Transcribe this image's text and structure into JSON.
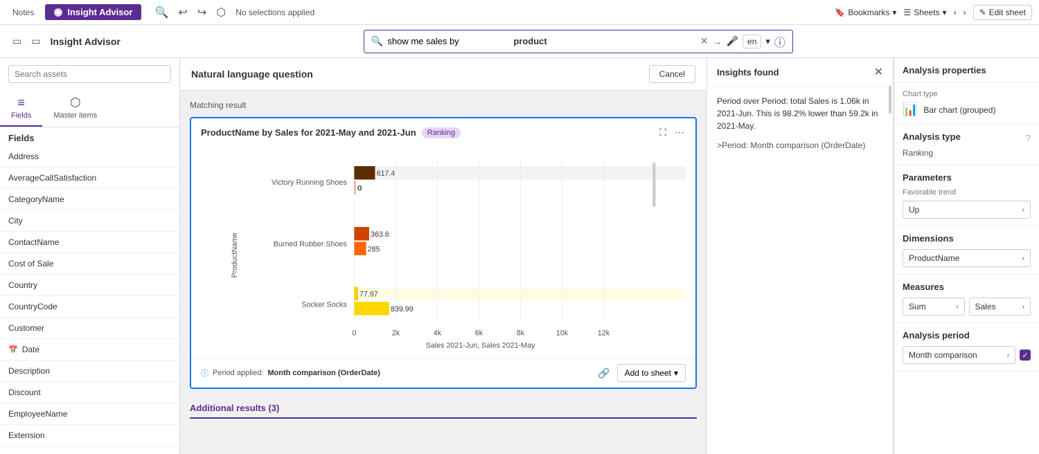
{
  "topbar": {
    "notes_label": "Notes",
    "insight_advisor_label": "Insight Advisor",
    "selections_label": "No selections applied",
    "bookmarks_label": "Bookmarks",
    "sheets_label": "Sheets",
    "edit_sheet_label": "Edit sheet"
  },
  "secondbar": {
    "title": "Insight Advisor",
    "search_placeholder": "show me sales by product",
    "search_bold_word": "product",
    "lang_value": "en"
  },
  "sidebar": {
    "search_placeholder": "Search assets",
    "fields_label": "Fields",
    "master_items_label": "Master items",
    "fields_header": "Fields",
    "field_items": [
      {
        "name": "Address",
        "icon": ""
      },
      {
        "name": "AverageCallSatisfaction",
        "icon": ""
      },
      {
        "name": "CategoryName",
        "icon": ""
      },
      {
        "name": "City",
        "icon": ""
      },
      {
        "name": "ContactName",
        "icon": ""
      },
      {
        "name": "Cost of Sale",
        "icon": ""
      },
      {
        "name": "Country",
        "icon": ""
      },
      {
        "name": "CountryCode",
        "icon": ""
      },
      {
        "name": "Customer",
        "icon": ""
      },
      {
        "name": "Date",
        "icon": "calendar"
      },
      {
        "name": "Description",
        "icon": ""
      },
      {
        "name": "Discount",
        "icon": ""
      },
      {
        "name": "EmployeeName",
        "icon": ""
      },
      {
        "name": "Extension",
        "icon": ""
      }
    ]
  },
  "content": {
    "header_title": "Natural language question",
    "cancel_label": "Cancel",
    "matching_result_label": "Matching result",
    "chart": {
      "title": "ProductName by Sales for 2021-May and 2021-Jun",
      "badge": "Ranking",
      "period_label": "Period applied:",
      "period_value": "Month comparison (OrderDate)",
      "add_to_sheet_label": "Add to sheet",
      "x_axis_label": "Sales 2021-Jun, Sales 2021-May",
      "bars": [
        {
          "product": "Victory Running Shoes",
          "may_val": 617.4,
          "jun_val": 0
        },
        {
          "product": "Burned Rubber Shoes",
          "may_val": 363.6,
          "jun_val": 285
        },
        {
          "product": "Socker Socks",
          "may_val": 77.97,
          "jun_val": 839.99
        }
      ],
      "x_ticks": [
        "0",
        "2k",
        "4k",
        "6k",
        "8k",
        "10k",
        "12k"
      ]
    },
    "additional_results_label": "Additional results (3)"
  },
  "insights": {
    "title": "Insights found",
    "body_text": "Period over Period: total Sales is 1.06k in 2021-Jun. This is 98.2% lower than 59.2k in 2021-May.",
    "period_text": ">Period: Month comparison (OrderDate)"
  },
  "analysis_panel": {
    "header": "Analysis properties",
    "chart_type_label": "Chart type",
    "chart_type_value": "Bar chart (grouped)",
    "analysis_type_label": "Analysis type",
    "analysis_type_value": "Ranking",
    "parameters_label": "Parameters",
    "favorable_trend_label": "Favorable trend",
    "favorable_trend_value": "Up",
    "dimensions_label": "Dimensions",
    "dimension_value": "ProductName",
    "measures_label": "Measures",
    "measure_sum": "Sum",
    "measure_sales": "Sales",
    "analysis_period_label": "Analysis period",
    "analysis_period_value": "Month comparison"
  }
}
